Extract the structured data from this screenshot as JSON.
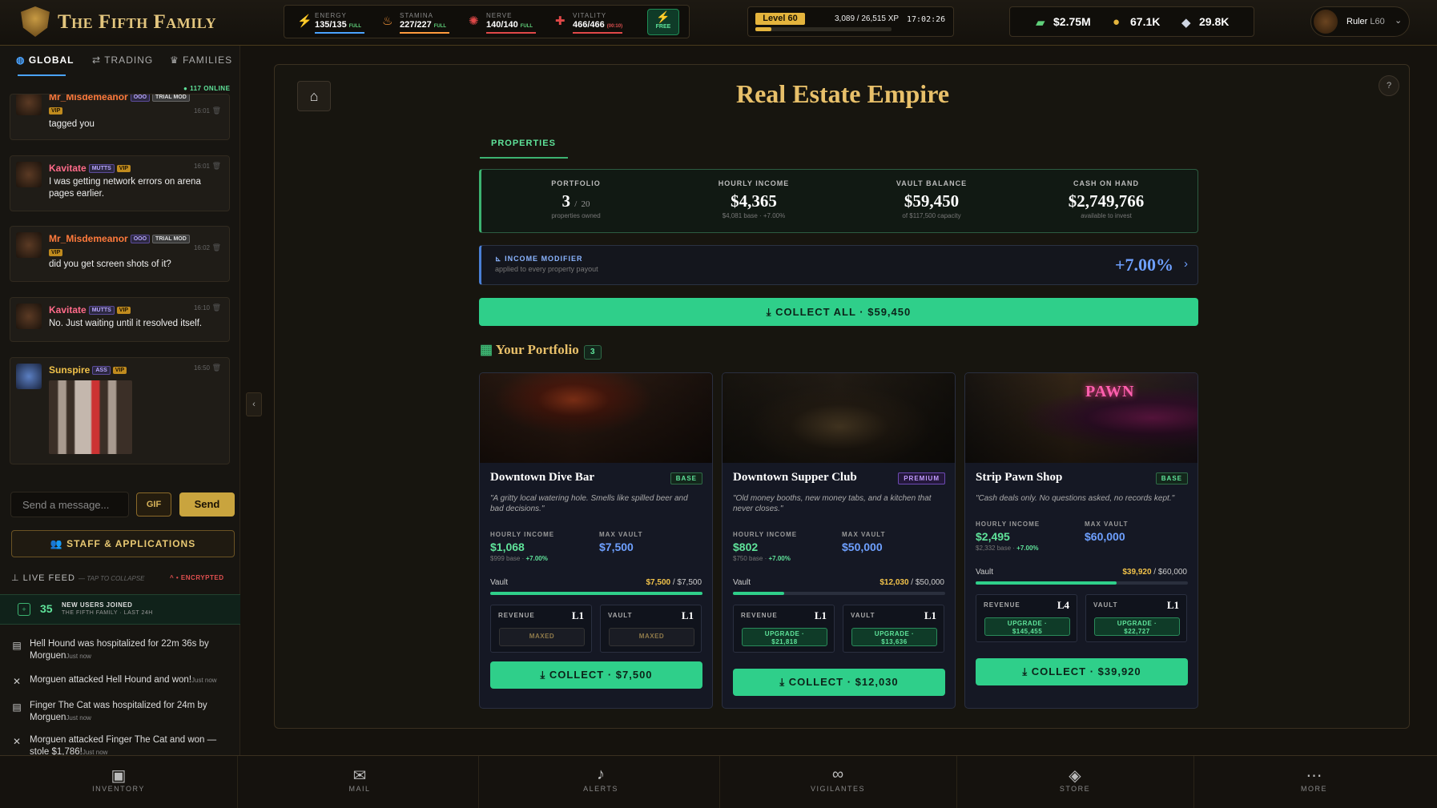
{
  "brand": {
    "name": "The Fifth Family"
  },
  "stats": [
    {
      "label": "ENERGY",
      "value": "135/135",
      "tag": "FULL",
      "color": "#4aa3ff",
      "icon": "lightning-icon"
    },
    {
      "label": "STAMINA",
      "value": "227/227",
      "tag": "FULL",
      "color": "#ff9a3c",
      "icon": "flame-icon"
    },
    {
      "label": "NERVE",
      "value": "140/140",
      "tag": "FULL",
      "color": "#e04848",
      "icon": "brain-icon"
    },
    {
      "label": "VITALITY",
      "value": "466/466",
      "tag": "(00:10)",
      "color": "#e04848",
      "icon": "heart-icon"
    }
  ],
  "free_button": {
    "label": "FREE"
  },
  "level": {
    "badge": "Level 60",
    "xp": "3,089 / 26,515 XP",
    "time": "17:02:26",
    "progress": 0.116
  },
  "currencies": [
    {
      "value": "$2.75M",
      "icon": "cash-icon"
    },
    {
      "value": "67.1K",
      "icon": "coin-icon"
    },
    {
      "value": "29.8K",
      "icon": "diamond-icon"
    }
  ],
  "user": {
    "name": "Ruler",
    "level": "L60"
  },
  "chat": {
    "tabs": [
      "GLOBAL",
      "TRADING",
      "FAMILIES"
    ],
    "online": "117 ONLINE",
    "messages": [
      {
        "name": "Mr_Misdemeanor",
        "name_color": "#ff7a3c",
        "tags": [
          "OOO",
          "TRIAL MOD",
          "VIP"
        ],
        "time": "16:01",
        "text": "tagged you"
      },
      {
        "name": "Kavitate",
        "name_color": "#ff6b8a",
        "tags": [
          "MUTTS",
          "VIP"
        ],
        "time": "16:01",
        "text": "I was getting network errors on arena pages earlier."
      },
      {
        "name": "Mr_Misdemeanor",
        "name_color": "#ff7a3c",
        "tags": [
          "OOO",
          "TRIAL MOD",
          "VIP"
        ],
        "time": "16:02",
        "text": "did you get screen shots of it?"
      },
      {
        "name": "Kavitate",
        "name_color": "#ff6b8a",
        "tags": [
          "MUTTS",
          "VIP"
        ],
        "time": "16:10",
        "text": "No. Just waiting until it resolved itself."
      },
      {
        "name": "Sunspire",
        "name_color": "#f1c24a",
        "tags": [
          "ASS",
          "VIP"
        ],
        "time": "16:50",
        "text": ""
      }
    ],
    "input_placeholder": "Send a message...",
    "gif_label": "GIF",
    "send_label": "Send",
    "staff_label": "STAFF & APPLICATIONS"
  },
  "feed": {
    "title": "LIVE FEED",
    "subtitle": "— TAP TO COLLAPSE",
    "encrypted": "• ENCRYPTED",
    "new_users": {
      "count": "35",
      "line1": "NEW USERS JOINED",
      "line2": "THE FIFTH FAMILY · LAST 24H"
    },
    "items": [
      {
        "text": "Hell Hound was hospitalized for 22m 36s by Morguen",
        "time": "Just now",
        "icon": "hospital-icon"
      },
      {
        "text": "Morguen attacked Hell Hound and won!",
        "time": "Just now",
        "icon": "swords-icon"
      },
      {
        "text": "Finger The Cat was hospitalized for 24m by Morguen",
        "time": "Just now",
        "icon": "hospital-icon"
      },
      {
        "text": "Morguen attacked Finger The Cat and won — stole $1,786!",
        "time": "Just now",
        "icon": "swords-icon"
      }
    ]
  },
  "page": {
    "title": "Real Estate Empire",
    "tab": "PROPERTIES",
    "summary": [
      {
        "label": "PORTFOLIO",
        "value": "3",
        "value_small": "20",
        "sub": "properties owned"
      },
      {
        "label": "HOURLY INCOME",
        "value": "$4,365",
        "sub": "$4,081 base · +7.00%"
      },
      {
        "label": "VAULT BALANCE",
        "value": "$59,450",
        "sub": "of $117,500 capacity"
      },
      {
        "label": "CASH ON HAND",
        "value": "$2,749,766",
        "sub": "available to invest"
      }
    ],
    "modifier": {
      "title": "INCOME MODIFIER",
      "sub": "applied to every property payout",
      "value": "+7.00%"
    },
    "collect_all": "COLLECT ALL · $59,450",
    "portfolio_title": "Your Portfolio",
    "portfolio_count": "3",
    "properties": [
      {
        "name": "Downtown Dive Bar",
        "badge": "BASE",
        "badge_type": "base",
        "desc": "\"A gritty local watering hole. Smells like spilled beer and bad decisions.\"",
        "hourly_label": "HOURLY INCOME",
        "hourly": "$1,068",
        "hourly_sub": "$999 base ·",
        "hourly_bonus": "+7.00%",
        "vault_label": "MAX VAULT",
        "vault_max": "$7,500",
        "vault_text": "Vault",
        "vault_current": "$7,500",
        "vault_total": " / $7,500",
        "vault_fill": 1.0,
        "revenue_label": "REVENUE",
        "revenue_level": "L1",
        "revenue_btn": "MAXED",
        "revenue_btn2": "",
        "vaultup_label": "VAULT",
        "vaultup_level": "L1",
        "vaultup_btn": "MAXED",
        "vaultup_btn2": "",
        "collect": "COLLECT · $7,500"
      },
      {
        "name": "Downtown Supper Club",
        "badge": "PREMIUM",
        "badge_type": "premium",
        "desc": "\"Old money booths, new money tabs, and a kitchen that never closes.\"",
        "hourly_label": "HOURLY INCOME",
        "hourly": "$802",
        "hourly_sub": "$750 base ·",
        "hourly_bonus": "+7.00%",
        "vault_label": "MAX VAULT",
        "vault_max": "$50,000",
        "vault_text": "Vault",
        "vault_current": "$12,030",
        "vault_total": " / $50,000",
        "vault_fill": 0.2406,
        "revenue_label": "REVENUE",
        "revenue_level": "L1",
        "revenue_btn": "UPGRADE ·",
        "revenue_btn2": "$21,818",
        "vaultup_label": "VAULT",
        "vaultup_level": "L1",
        "vaultup_btn": "UPGRADE ·",
        "vaultup_btn2": "$13,636",
        "collect": "COLLECT · $12,030"
      },
      {
        "name": "Strip Pawn Shop",
        "badge": "BASE",
        "badge_type": "base",
        "desc": "\"Cash deals only. No questions asked, no records kept.\"",
        "hourly_label": "HOURLY INCOME",
        "hourly": "$2,495",
        "hourly_sub": "$2,332 base ·",
        "hourly_bonus": "+7.00%",
        "vault_label": "MAX VAULT",
        "vault_max": "$60,000",
        "vault_text": "Vault",
        "vault_current": "$39,920",
        "vault_total": " / $60,000",
        "vault_fill": 0.6653,
        "revenue_label": "REVENUE",
        "revenue_level": "L4",
        "revenue_btn": "UPGRADE ·",
        "revenue_btn2": "$145,455",
        "vaultup_label": "VAULT",
        "vaultup_level": "L1",
        "vaultup_btn": "UPGRADE ·",
        "vaultup_btn2": "$22,727",
        "collect": "COLLECT · $39,920",
        "sign": "PAWN"
      }
    ]
  },
  "bottom_nav": [
    {
      "label": "INVENTORY",
      "icon": "briefcase-icon"
    },
    {
      "label": "MAIL",
      "icon": "mail-icon"
    },
    {
      "label": "ALERTS",
      "icon": "bell-icon"
    },
    {
      "label": "VIGILANTES",
      "icon": "mask-icon"
    },
    {
      "label": "STORE",
      "icon": "gem-icon"
    },
    {
      "label": "MORE",
      "icon": "more-icon"
    }
  ]
}
